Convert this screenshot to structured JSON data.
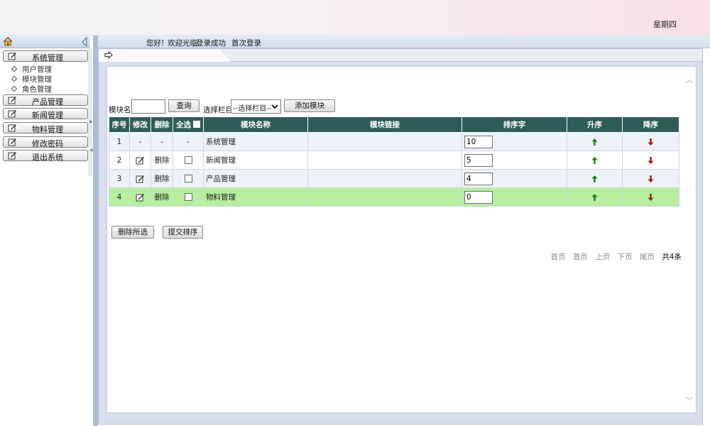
{
  "header": {
    "weekday": "星期四"
  },
  "welcome": {
    "greeting": "您好!",
    "message": "欢迎光临",
    "login_status": "登录成功",
    "login_count": "首次登录"
  },
  "sidebar": {
    "menus": [
      {
        "label": "系统管理",
        "icon": "edit-icon"
      },
      {
        "label": "产品管理",
        "icon": "edit-icon"
      },
      {
        "label": "新闻管理",
        "icon": "edit-icon"
      },
      {
        "label": "物料管理",
        "icon": "edit-icon"
      },
      {
        "label": "修改密码",
        "icon": "edit-icon"
      },
      {
        "label": "退出系统",
        "icon": "edit-icon"
      }
    ],
    "submenu": [
      "用户管理",
      "模块管理",
      "角色管理"
    ]
  },
  "toolbar": {
    "module_name_label": "模块名",
    "module_name_value": "",
    "query_label": "查询",
    "column_label": "选择栏目",
    "column_selected": "--选择栏目--",
    "add_module_label": "添加模块"
  },
  "table": {
    "headers": [
      "序号",
      "修改",
      "删除",
      "全选",
      "模块名称",
      "模块链接",
      "排序字",
      "升序",
      "降序"
    ],
    "rows": [
      {
        "no": "1",
        "edit": "-",
        "delete": "-",
        "select": "-",
        "name": "系统管理",
        "link": "",
        "sort": "10"
      },
      {
        "no": "2",
        "edit": "",
        "delete": "删除",
        "select": "",
        "name": "新闻管理",
        "link": "",
        "sort": "5"
      },
      {
        "no": "3",
        "edit": "",
        "delete": "删除",
        "select": "",
        "name": "产品管理",
        "link": "",
        "sort": "4"
      },
      {
        "no": "4",
        "edit": "",
        "delete": "删除",
        "select": "",
        "name": "物料管理",
        "link": "",
        "sort": "0"
      }
    ]
  },
  "actions": {
    "delete_selected": "删除所选",
    "submit_sort": "提交排序"
  },
  "pager": {
    "first": "首页",
    "prev_first": "首页",
    "prev": "上页",
    "next": "下页",
    "last": "尾页",
    "total": "共4条"
  },
  "colors": {
    "table_header": "#2f5d56",
    "row_highlight": "#b5ef9f",
    "row_alt": "#eef1f7",
    "arrow_up": "#1a7a1a",
    "arrow_down": "#9a1a1a"
  }
}
